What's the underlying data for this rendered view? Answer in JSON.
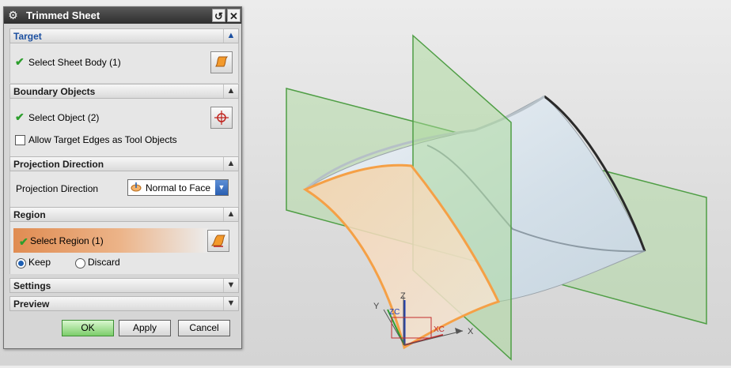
{
  "dialog": {
    "title": "Trimmed Sheet",
    "reset_icon": "reset-icon",
    "close_icon": "close-icon",
    "sections": {
      "target": {
        "label": "Target",
        "state": "expanded"
      },
      "boundary": {
        "label": "Boundary Objects",
        "state": "expanded"
      },
      "projection": {
        "label": "Projection Direction",
        "state": "expanded"
      },
      "region": {
        "label": "Region",
        "state": "expanded"
      },
      "settings": {
        "label": "Settings",
        "state": "collapsed"
      },
      "preview": {
        "label": "Preview",
        "state": "collapsed"
      }
    },
    "target": {
      "select_label": "Select Sheet Body (1)"
    },
    "boundary": {
      "select_label": "Select Object (2)",
      "allow_edges_label": "Allow Target Edges as Tool Objects",
      "allow_edges_checked": false
    },
    "projection": {
      "label": "Projection Direction",
      "value": "Normal to Face"
    },
    "region": {
      "select_label": "Select Region (1)",
      "keep_label": "Keep",
      "discard_label": "Discard",
      "selected": "Keep"
    },
    "buttons": {
      "ok": "OK",
      "apply": "Apply",
      "cancel": "Cancel"
    }
  },
  "viewport": {
    "axis_labels": {
      "z": "Z",
      "y": "Y",
      "x": "X",
      "zc": "ZC",
      "xc": "XC"
    },
    "colors": {
      "plane_fill": "#a9d99a",
      "plane_edge": "#4f9e45",
      "surface_fill": "#dce6ee",
      "region_fill": "#f6d8b8",
      "region_edge": "#f5a046",
      "edge_dark": "#2a2a2a"
    }
  }
}
